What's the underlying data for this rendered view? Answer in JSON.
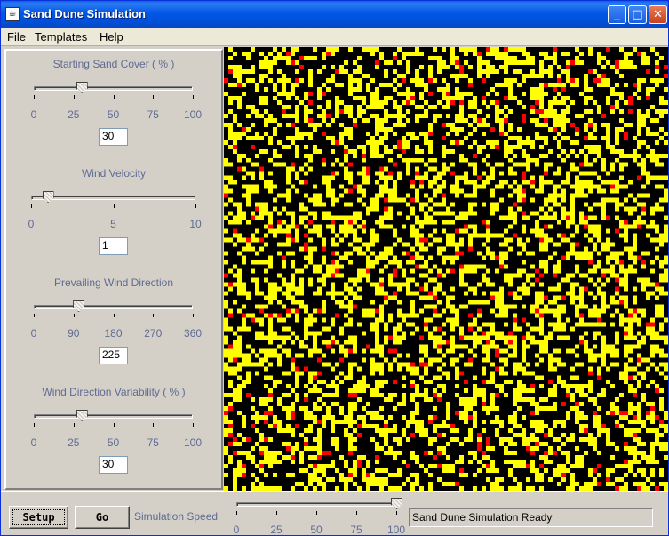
{
  "window": {
    "title": "Sand Dune Simulation",
    "icon": "java-cup-icon"
  },
  "menu": [
    "File",
    "Templates",
    "Help"
  ],
  "sliders": [
    {
      "title": "Starting Sand Cover ( % )",
      "ticks": [
        "0",
        "25",
        "50",
        "75",
        "100"
      ],
      "value": "30",
      "fraction": 0.3
    },
    {
      "title": "Wind Velocity",
      "ticks": [
        "0",
        "5",
        "10"
      ],
      "value": "1",
      "fraction": 0.1
    },
    {
      "title": "Prevailing Wind Direction",
      "ticks": [
        "0",
        "90",
        "180",
        "270",
        "360"
      ],
      "value": "225",
      "fraction": 0.28
    },
    {
      "title": "Wind Direction Variability ( % )",
      "ticks": [
        "0",
        "25",
        "50",
        "75",
        "100"
      ],
      "value": "30",
      "fraction": 0.3
    }
  ],
  "controls": {
    "setup_label": "Setup",
    "go_label": "Go",
    "speed_label": "Simulation Speed",
    "speed_ticks": [
      "0",
      "25",
      "50",
      "75",
      "100"
    ],
    "speed_fraction": 1.0,
    "status": "Sand Dune Simulation Ready"
  },
  "grid": {
    "columns": 100,
    "rows": 100,
    "colors": {
      "empty": "#000000",
      "sand": "#ffff00",
      "moving": "#ff0000"
    }
  }
}
